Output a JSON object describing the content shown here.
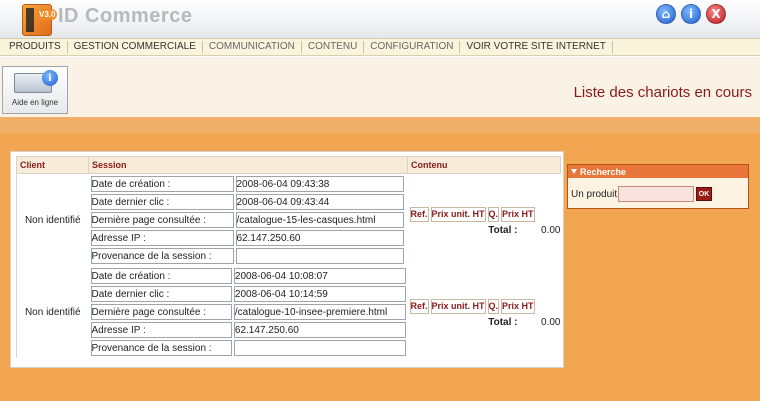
{
  "app": {
    "title": "ID Commerce",
    "version": "V3.0"
  },
  "header_buttons": {
    "home": "⌂",
    "info": "i",
    "close": "X"
  },
  "menu": [
    {
      "label": "PRODUITS"
    },
    {
      "label": "GESTION COMMERCIALE"
    },
    {
      "label": "COMMUNICATION"
    },
    {
      "label": "CONTENU"
    },
    {
      "label": "CONFIGURATION"
    },
    {
      "label": "VOIR VOTRE SITE INTERNET"
    }
  ],
  "toolbar": {
    "help_label": "Aide en ligne",
    "help_badge": "i"
  },
  "page": {
    "title": "Liste des chariots en cours"
  },
  "table": {
    "headers": {
      "client": "Client",
      "session": "Session",
      "contenu": "Contenu"
    },
    "cart_headers": {
      "ref": "Ref.",
      "unit_price": "Prix unit. HT",
      "qty": "Q.",
      "price": "Prix HT"
    },
    "total_label": "Total :",
    "rows": [
      {
        "client": "Non identifié",
        "session": [
          {
            "key": "Date de création :",
            "value": "2008-06-04 09:43:38"
          },
          {
            "key": "Date dernier clic :",
            "value": "2008-06-04 09:43:44"
          },
          {
            "key": "Dernière page consultée :",
            "value": "/catalogue-15-les-casques.html"
          },
          {
            "key": "Adresse IP :",
            "value": "62.147.250.60"
          },
          {
            "key": "Provenance de la session :",
            "value": ""
          }
        ],
        "total": "0.00"
      },
      {
        "client": "Non identifié",
        "session": [
          {
            "key": "Date de création :",
            "value": "2008-06-04 10:08:07"
          },
          {
            "key": "Date dernier clic :",
            "value": "2008-06-04 10:14:59"
          },
          {
            "key": "Dernière page consultée :",
            "value": "/catalogue-10-insee-premiere.html"
          },
          {
            "key": "Adresse IP :",
            "value": "62.147.250.60"
          },
          {
            "key": "Provenance de la session :",
            "value": ""
          }
        ],
        "total": "0.00"
      }
    ]
  },
  "search": {
    "title": "Recherche",
    "label": "Un produit",
    "value": "",
    "button": "OK"
  },
  "colors": {
    "accent": "#f3a652",
    "title_red": "#8a1a1a",
    "menu_bg": "#fbf4dc",
    "search_head": "#e8753a"
  }
}
